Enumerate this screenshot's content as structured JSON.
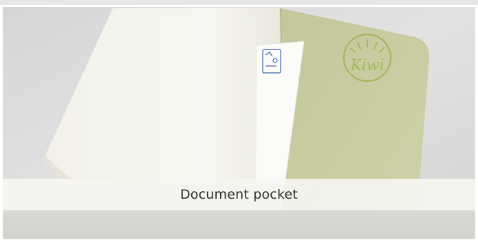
{
  "caption": {
    "text": "Document pocket"
  },
  "colors": {
    "background": "#ffffff",
    "photo_backdrop": "#dcdcdc",
    "cover_green": "#c9cca0",
    "stamp_green": "#a3b85a",
    "caption_bar": "#f7f6f2",
    "caption_text": "#2b2b2b"
  },
  "photo": {
    "subject": "open notebook with green cover and document pocket",
    "logo_text": "Kiwi"
  }
}
